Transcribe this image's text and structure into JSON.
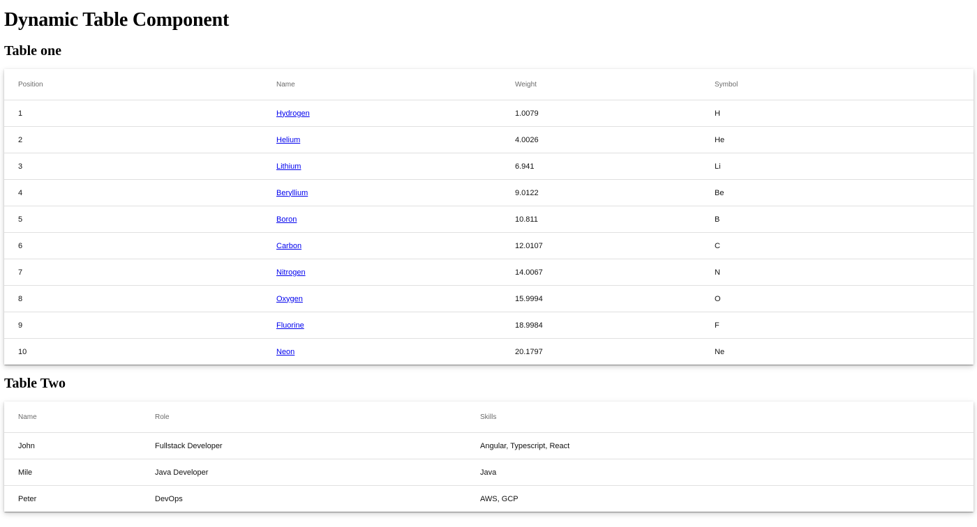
{
  "page": {
    "title": "Dynamic Table Component"
  },
  "table_one": {
    "title": "Table one",
    "columns": [
      "Position",
      "Name",
      "Weight",
      "Symbol"
    ],
    "rows": [
      {
        "position": "1",
        "name": "Hydrogen",
        "weight": "1.0079",
        "symbol": "H"
      },
      {
        "position": "2",
        "name": "Helium",
        "weight": "4.0026",
        "symbol": "He"
      },
      {
        "position": "3",
        "name": "Lithium",
        "weight": "6.941",
        "symbol": "Li"
      },
      {
        "position": "4",
        "name": "Beryllium",
        "weight": "9.0122",
        "symbol": "Be"
      },
      {
        "position": "5",
        "name": "Boron",
        "weight": "10.811",
        "symbol": "B"
      },
      {
        "position": "6",
        "name": "Carbon",
        "weight": "12.0107",
        "symbol": "C"
      },
      {
        "position": "7",
        "name": "Nitrogen",
        "weight": "14.0067",
        "symbol": "N"
      },
      {
        "position": "8",
        "name": "Oxygen",
        "weight": "15.9994",
        "symbol": "O"
      },
      {
        "position": "9",
        "name": "Fluorine",
        "weight": "18.9984",
        "symbol": "F"
      },
      {
        "position": "10",
        "name": "Neon",
        "weight": "20.1797",
        "symbol": "Ne"
      }
    ]
  },
  "table_two": {
    "title": "Table Two",
    "columns": [
      "Name",
      "Role",
      "Skills"
    ],
    "rows": [
      {
        "name": "John",
        "role": "Fullstack Developer",
        "skills": "Angular, Typescript, React"
      },
      {
        "name": "Mile",
        "role": "Java Developer",
        "skills": "Java"
      },
      {
        "name": "Peter",
        "role": "DevOps",
        "skills": "AWS, GCP"
      }
    ]
  },
  "colors": {
    "link": "#0000ee",
    "header_text": "#6b6b6b",
    "row_divider": "#e0e0e0"
  }
}
